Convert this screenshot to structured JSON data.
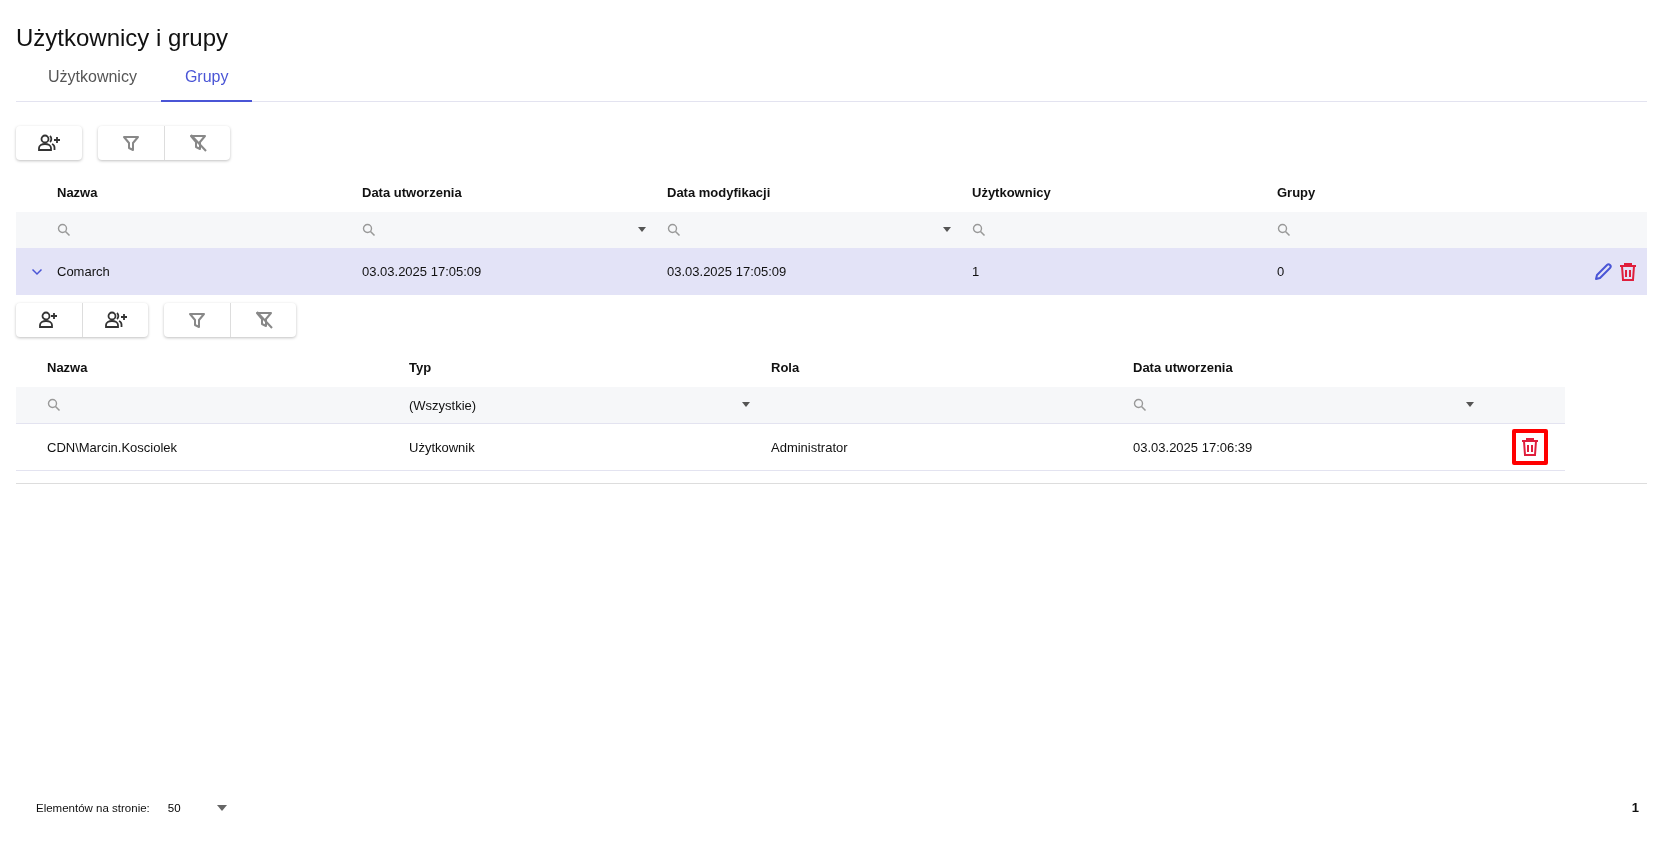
{
  "title": "Użytkownicy i grupy",
  "tabs": [
    {
      "label": "Użytkownicy",
      "selected": false
    },
    {
      "label": "Grupy",
      "selected": true
    }
  ],
  "table": {
    "columns": [
      {
        "label": "Nazwa",
        "filter": {
          "kind": "search"
        }
      },
      {
        "label": "Data utworzenia",
        "filter": {
          "kind": "date"
        }
      },
      {
        "label": "Data modyfikacji",
        "filter": {
          "kind": "date"
        }
      },
      {
        "label": "Użytkownicy",
        "filter": {
          "kind": "search"
        }
      },
      {
        "label": "Grupy",
        "filter": {
          "kind": "search"
        }
      }
    ],
    "rows": [
      {
        "expanded": true,
        "selected": true,
        "cells": [
          "Comarch",
          "03.03.2025 17:05:09",
          "03.03.2025 17:05:09",
          "1",
          "0"
        ],
        "subtable": {
          "columns": [
            {
              "label": "Nazwa",
              "filter": {
                "kind": "search"
              }
            },
            {
              "label": "Typ",
              "filter": {
                "kind": "select",
                "value": "(Wszystkie)"
              }
            },
            {
              "label": "Rola",
              "filter": {
                "kind": "none"
              }
            },
            {
              "label": "Data utworzenia",
              "filter": {
                "kind": "date"
              }
            }
          ],
          "rows": [
            {
              "cells": [
                "CDN\\Marcin.Kosciolek",
                "Użytkownik",
                "Administrator",
                "03.03.2025 17:06:39"
              ],
              "highlighted": true
            }
          ]
        }
      }
    ]
  },
  "footer": {
    "page_size_label": "Elementów na stronie:",
    "page_size": "50",
    "page": "1"
  }
}
